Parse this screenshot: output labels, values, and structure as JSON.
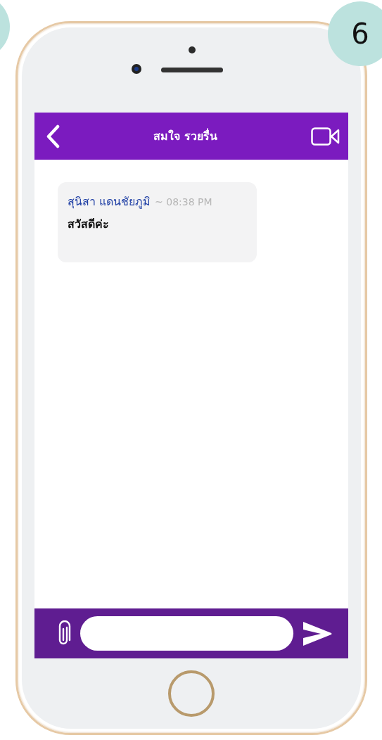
{
  "step_badge": "6",
  "header": {
    "title": "สมใจ รวยรื่น"
  },
  "messages": [
    {
      "sender": "สุนิสา แดนชัยภูมิ",
      "time": "~ 08:38 PM",
      "text": "สวัสดีค่ะ"
    }
  ]
}
